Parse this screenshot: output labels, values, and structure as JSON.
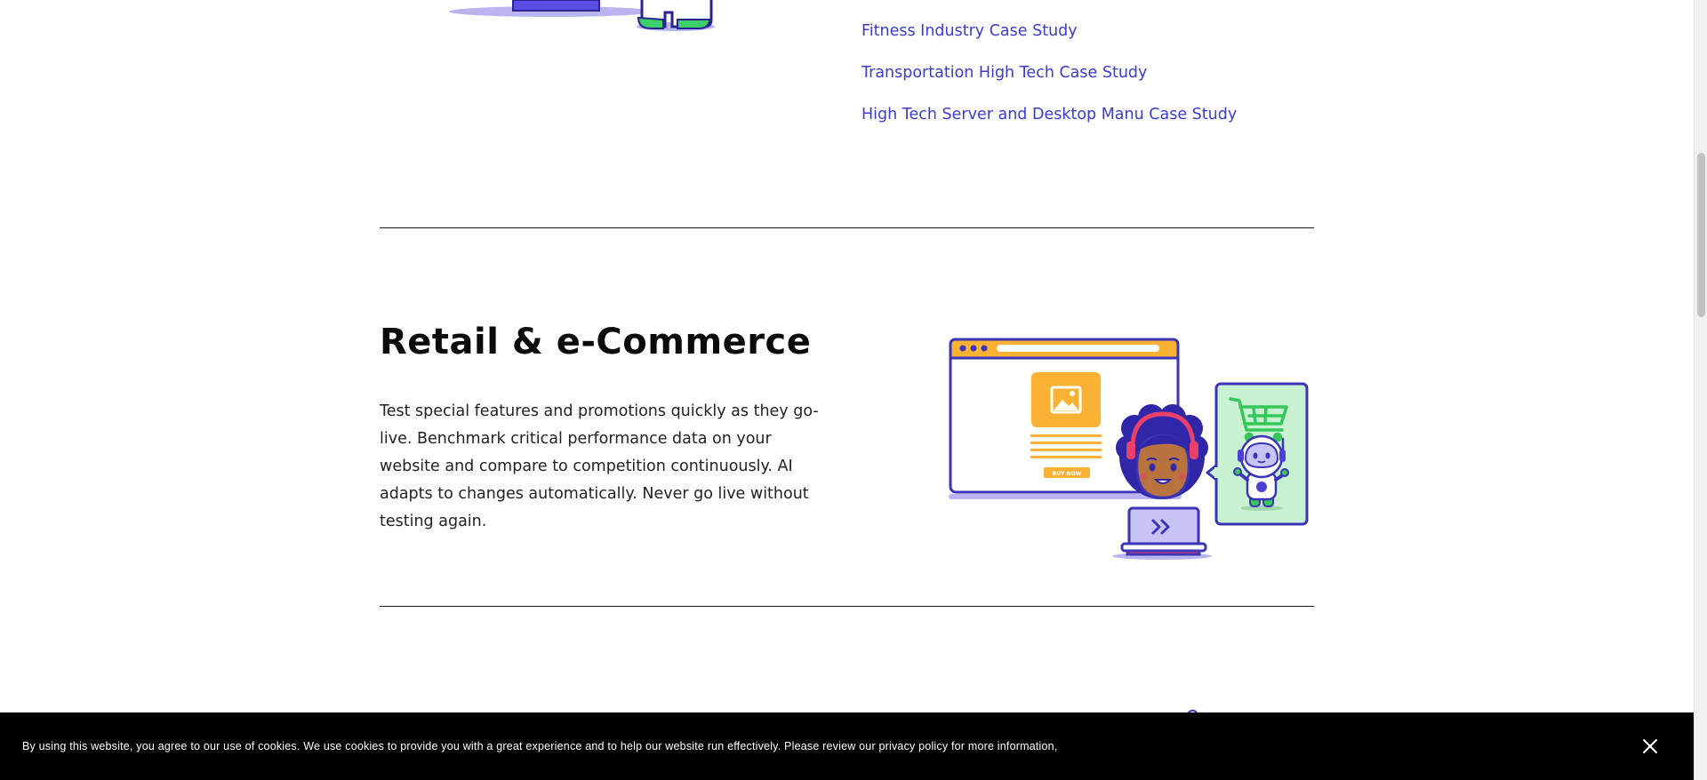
{
  "case_studies": {
    "links": [
      "Fitness Industry Case Study",
      "Transportation High Tech Case Study",
      "High Tech Server and Desktop Manu Case Study"
    ]
  },
  "retail_section": {
    "title": "Retail & e-Commerce",
    "body": "Test special features and promotions quickly as they go-live. Benchmark critical performance data on your website and compare to competition continuously. AI adapts to changes automatically. Never go live without testing again.",
    "illustration": {
      "buy_button_text": "BUY NOW",
      "icons": [
        "browser-window-icon",
        "image-placeholder-icon",
        "shopping-cart-icon",
        "robot-mascot-icon",
        "person-with-laptop-icon"
      ]
    }
  },
  "cookie_banner": {
    "text": "By using this website, you agree to our use of cookies. We use cookies to provide you with a great experience and to help our website run effectively. Please review our privacy policy for more information,",
    "close_icon": "close-icon"
  },
  "colors": {
    "link": "#3b3bd1",
    "accent_purple": "#4b3fd6",
    "accent_orange": "#f9b233",
    "accent_green": "#34c759",
    "cookie_bg": "#000000"
  }
}
